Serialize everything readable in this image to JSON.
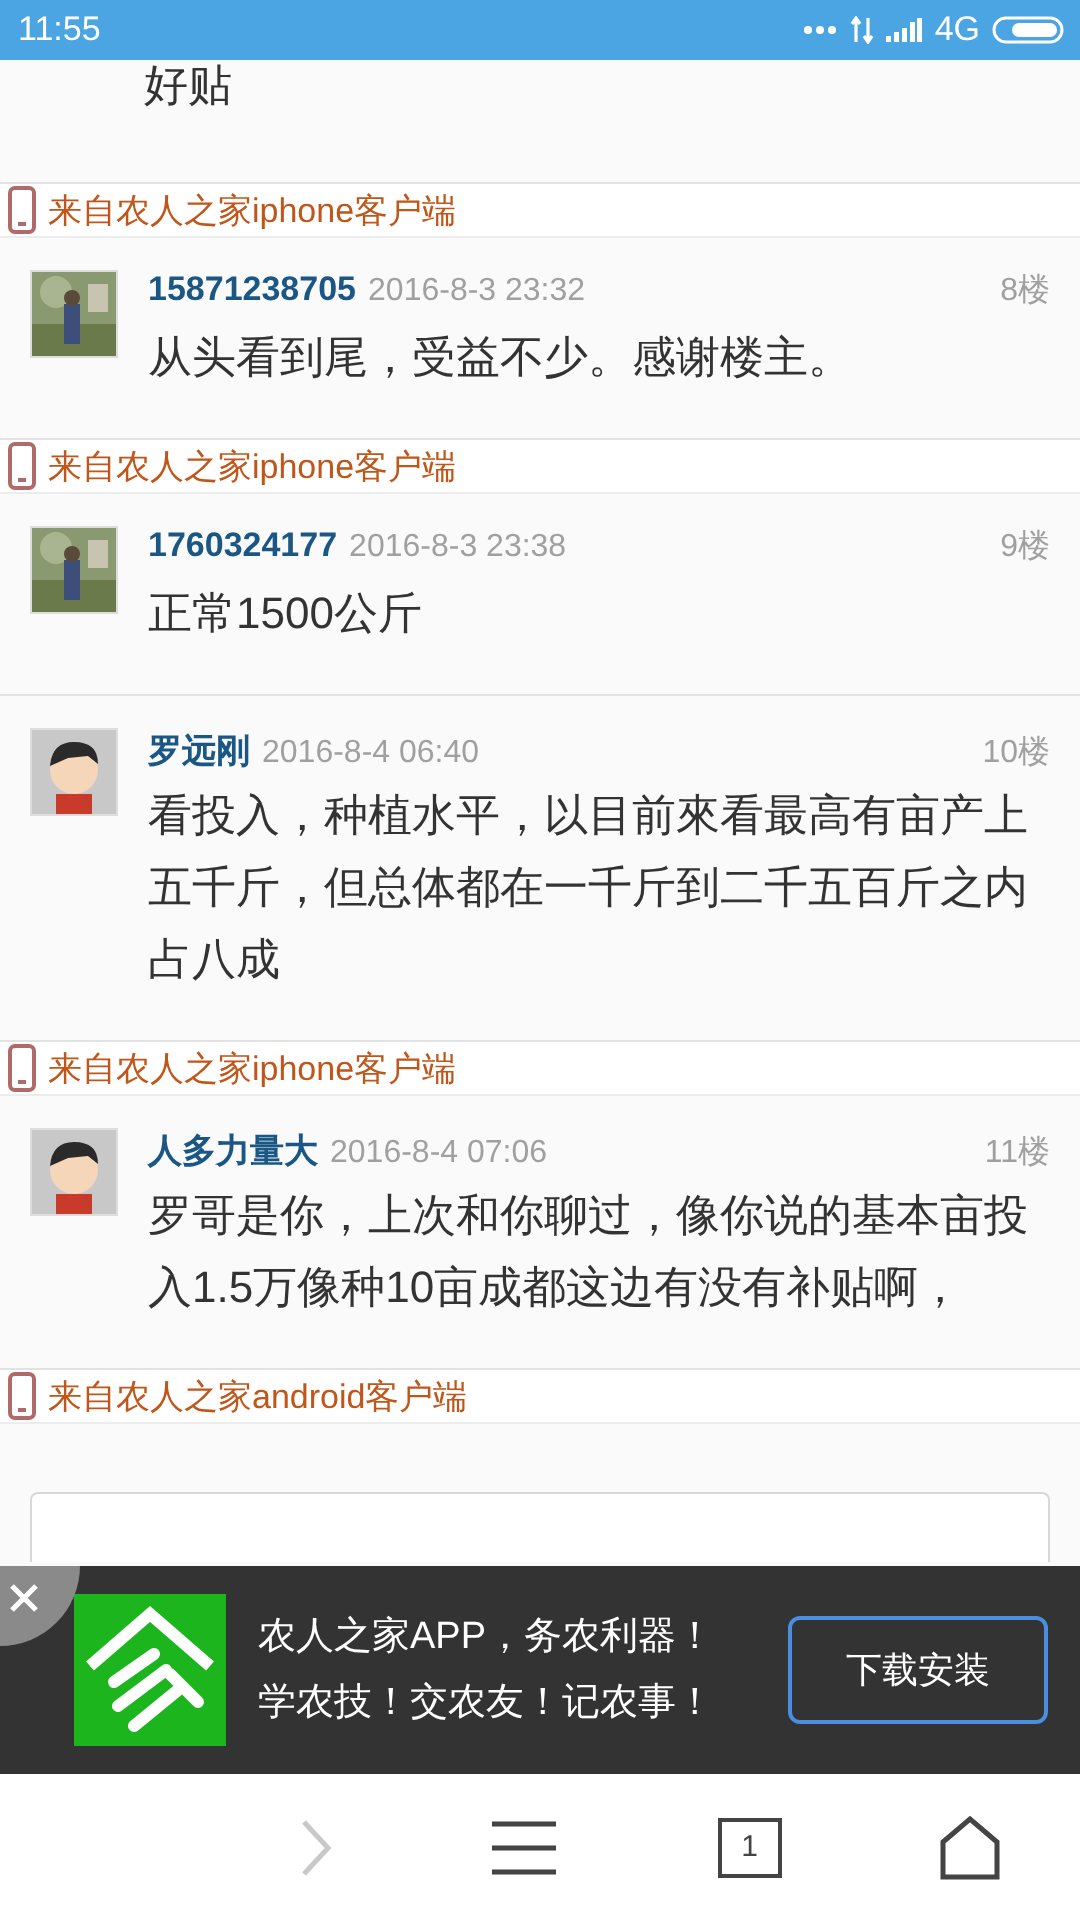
{
  "status_bar": {
    "time": "11:55",
    "network": "4G"
  },
  "posts": [
    {
      "kind": "partial",
      "content": "好贴",
      "source": "来自农人之家iphone客户端"
    },
    {
      "name": "15871238705",
      "time": "2016-8-3 23:32",
      "floor": "8楼",
      "content": "从头看到尾，受益不少。感谢楼主。",
      "source": "来自农人之家iphone客户端"
    },
    {
      "name": "1760324177",
      "time": "2016-8-3 23:38",
      "floor": "9楼",
      "content": "正常1500公斤"
    },
    {
      "kind": "cartoon",
      "name": "罗远刚",
      "time": "2016-8-4 06:40",
      "floor": "10楼",
      "content": "看投入，种植水平，以目前來看最高有亩产上五千斤，但总体都在一千斤到二千五百斤之内占八成",
      "source": "来自农人之家iphone客户端"
    },
    {
      "kind": "cartoon",
      "name": "人多力量大",
      "time": "2016-8-4 07:06",
      "floor": "11楼",
      "content": "罗哥是你，上次和你聊过，像你说的基本亩投入1.5万像种10亩成都这边有没有补贴啊，",
      "source": "来自农人之家android客户端"
    }
  ],
  "app_banner": {
    "lines": [
      "农人之家APP，务农利器！",
      "学农技！交农友！记农事！"
    ],
    "button": "下载安装"
  },
  "bottom_nav": {
    "tab_count": "1"
  }
}
